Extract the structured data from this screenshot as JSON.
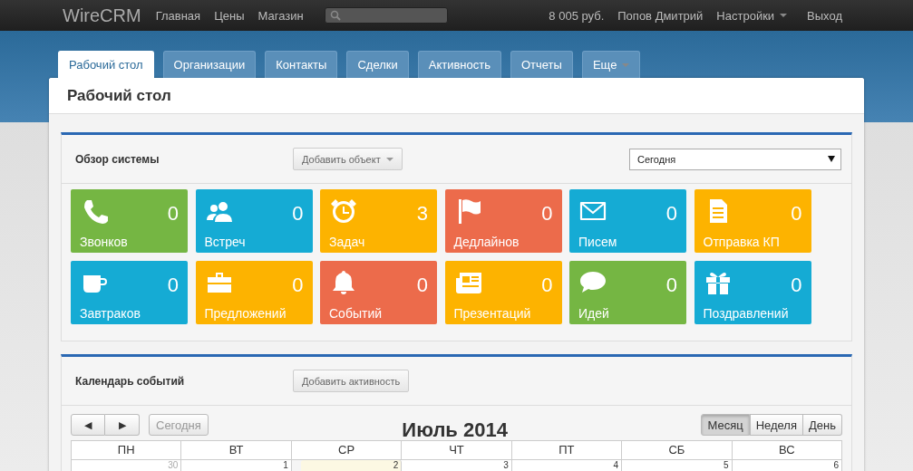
{
  "navbar": {
    "brand": "WireCRM",
    "links": [
      "Главная",
      "Цены",
      "Магазин"
    ],
    "balance": "8 005 руб.",
    "user": "Попов Дмитрий",
    "settings": "Настройки",
    "logout": "Выход"
  },
  "tabs": [
    {
      "label": "Рабочий стол",
      "selected": true,
      "has_menu": false
    },
    {
      "label": "Организации",
      "selected": false,
      "has_menu": false
    },
    {
      "label": "Контакты",
      "selected": false,
      "has_menu": false
    },
    {
      "label": "Сделки",
      "selected": false,
      "has_menu": false
    },
    {
      "label": "Активность",
      "selected": false,
      "has_menu": false
    },
    {
      "label": "Отчеты",
      "selected": false,
      "has_menu": false
    },
    {
      "label": "Еще",
      "selected": false,
      "has_menu": true
    }
  ],
  "page": {
    "title": "Рабочий стол"
  },
  "overview": {
    "title": "Обзор системы",
    "add_button": "Добавить объект",
    "period": "Сегодня",
    "tiles": [
      {
        "label": "Звонков",
        "count": "0",
        "color": "#75b643"
      },
      {
        "label": "Встреч",
        "count": "0",
        "color": "#15abd4"
      },
      {
        "label": "Задач",
        "count": "3",
        "color": "#fdb300"
      },
      {
        "label": "Дедлайнов",
        "count": "0",
        "color": "#ec6b4b"
      },
      {
        "label": "Писем",
        "count": "0",
        "color": "#15abd4"
      },
      {
        "label": "Отправка КП",
        "count": "0",
        "color": "#fdb300"
      },
      {
        "label": "Завтраков",
        "count": "0",
        "color": "#15abd4"
      },
      {
        "label": "Предложений",
        "count": "0",
        "color": "#fdb300"
      },
      {
        "label": "Событий",
        "count": "0",
        "color": "#ec6b4b"
      },
      {
        "label": "Презентаций",
        "count": "0",
        "color": "#fdb300"
      },
      {
        "label": "Идей",
        "count": "0",
        "color": "#75b643"
      },
      {
        "label": "Поздравлений",
        "count": "0",
        "color": "#15abd4"
      }
    ]
  },
  "calendar": {
    "title": "Календарь событий",
    "add_button": "Добавить активность",
    "prev": "◀",
    "next": "▶",
    "today_button": "Сегодня",
    "today_disabled": true,
    "month": "Июль 2014",
    "views": [
      {
        "label": "Месяц",
        "selected": true
      },
      {
        "label": "Неделя",
        "selected": false
      },
      {
        "label": "День",
        "selected": false
      }
    ],
    "weekdays": [
      "ПН",
      "ВТ",
      "СР",
      "ЧТ",
      "ПТ",
      "СБ",
      "ВС"
    ],
    "days": [
      {
        "date": "30",
        "muted": true,
        "today": false
      },
      {
        "date": "1",
        "muted": false,
        "today": false
      },
      {
        "date": "2",
        "muted": false,
        "today": true
      },
      {
        "date": "3",
        "muted": false,
        "today": false
      },
      {
        "date": "4",
        "muted": false,
        "today": false
      },
      {
        "date": "5",
        "muted": false,
        "today": false
      },
      {
        "date": "6",
        "muted": false,
        "today": false
      }
    ]
  }
}
